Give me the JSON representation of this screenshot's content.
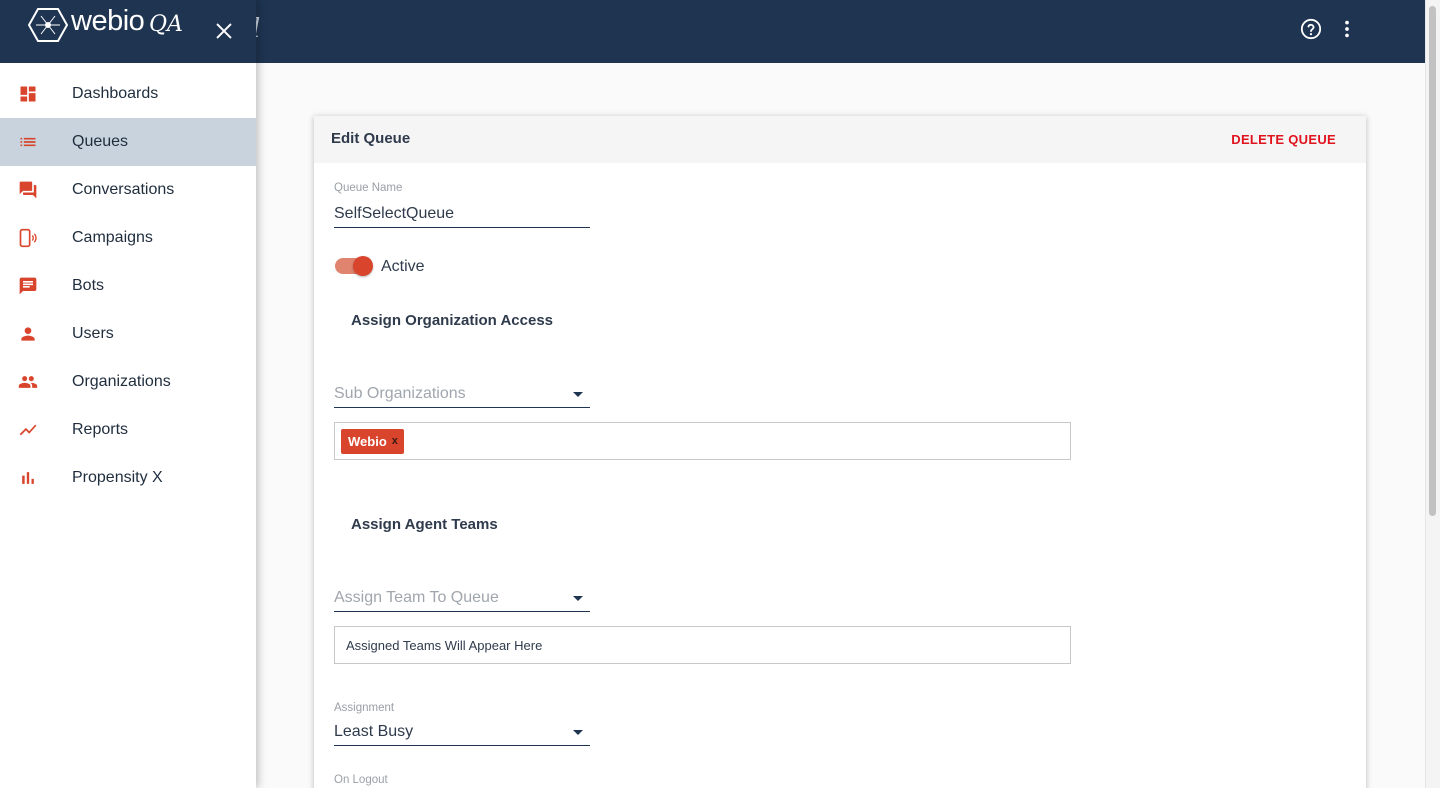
{
  "app": {
    "logo_text": "webio",
    "logo_suffix": "QA",
    "background_title_fragment": "l"
  },
  "topbar": {
    "help_icon": "help-circle-icon",
    "more_icon": "more-vert-icon"
  },
  "sidebar": {
    "items": [
      {
        "label": "Dashboards",
        "icon": "dashboard-icon"
      },
      {
        "label": "Queues",
        "icon": "list-icon",
        "active": true
      },
      {
        "label": "Conversations",
        "icon": "forum-icon"
      },
      {
        "label": "Campaigns",
        "icon": "phone-signal-icon"
      },
      {
        "label": "Bots",
        "icon": "chat-icon"
      },
      {
        "label": "Users",
        "icon": "person-icon"
      },
      {
        "label": "Organizations",
        "icon": "people-icon"
      },
      {
        "label": "Reports",
        "icon": "trend-icon"
      },
      {
        "label": "Propensity X",
        "icon": "bar-chart-icon"
      }
    ]
  },
  "card": {
    "title": "Edit Queue",
    "delete_label": "DELETE QUEUE",
    "queue_name_label": "Queue Name",
    "queue_name_value": "SelfSelectQueue",
    "active_label": "Active",
    "active_on": true,
    "org_access_title": "Assign Organization Access",
    "sub_org_placeholder": "Sub Organizations",
    "org_chips": [
      {
        "label": "Webio",
        "remove": "x"
      }
    ],
    "agent_teams_title": "Assign Agent Teams",
    "assign_team_placeholder": "Assign Team To Queue",
    "teams_empty_text": "Assigned Teams Will Appear Here",
    "assignment_label": "Assignment",
    "assignment_value": "Least Busy",
    "on_logout_label": "On Logout"
  },
  "colors": {
    "primary": "#1e3451",
    "accent": "#d9452c",
    "danger": "#e0141e",
    "active_nav": "#c9d3dd"
  }
}
